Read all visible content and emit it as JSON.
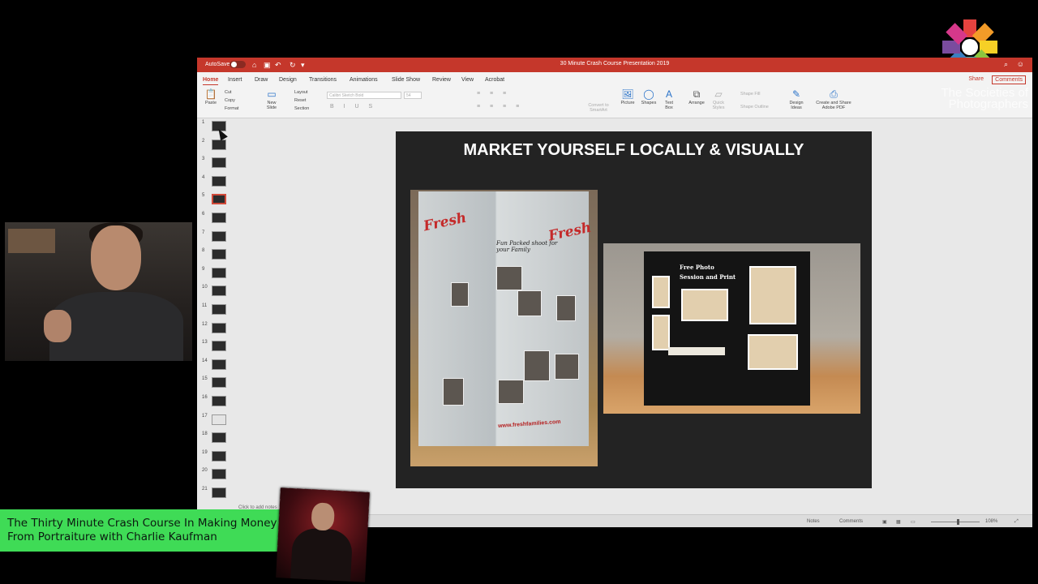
{
  "app": {
    "autosave_label": "AutoSave",
    "autosave_state": "OFF",
    "document_title": "30 Minute Crash Course Presentation 2019"
  },
  "menu": {
    "tabs": [
      "Home",
      "Insert",
      "Draw",
      "Design",
      "Transitions",
      "Animations",
      "Slide Show",
      "Review",
      "View",
      "Acrobat"
    ],
    "active_tab": "Home",
    "share_label": "Share",
    "comments_label": "Comments"
  },
  "ribbon": {
    "paste": "Paste",
    "cut": "Cut",
    "copy": "Copy",
    "format": "Format",
    "new_slide": "New Slide",
    "layout": "Layout",
    "reset": "Reset",
    "section": "Section",
    "font_name": "Calibri Sketch Bold",
    "font_size": "54",
    "convert_smartart": "Convert to SmartArt",
    "picture": "Picture",
    "shapes": "Shapes",
    "text_box": "Text Box",
    "arrange": "Arrange",
    "quick_styles": "Quick Styles",
    "shape_fill": "Shape Fill",
    "shape_outline": "Shape Outline",
    "design_ideas": "Design Ideas",
    "create_share_pdf": "Create and Share Adobe PDF"
  },
  "slides": {
    "numbers": [
      "1",
      "2",
      "3",
      "4",
      "5",
      "6",
      "7",
      "8",
      "9",
      "10",
      "11",
      "12",
      "13",
      "14",
      "15",
      "16",
      "17",
      "18",
      "19",
      "20",
      "21"
    ],
    "selected": "5"
  },
  "slide": {
    "title": "MARKET YOURSELF LOCALLY & VISUALLY",
    "banner_brand": "Fresh",
    "banner_tagline": "Fun Packed shoot for your Family",
    "banner_website": "www.freshfamilies.com",
    "booth_sign": "Free Photo Session and Print"
  },
  "notes": {
    "placeholder": "Click to add notes"
  },
  "status": {
    "notes": "Notes",
    "comments": "Comments",
    "zoom": "108%"
  },
  "overlay": {
    "caption": "The Thirty Minute Crash Course In Making Money From Portraiture with Charlie Kaufman",
    "logo_text": "The Societies of Photographers"
  },
  "colors": {
    "title_bar": "#c5372b",
    "caption_green": "#3fdb56"
  }
}
